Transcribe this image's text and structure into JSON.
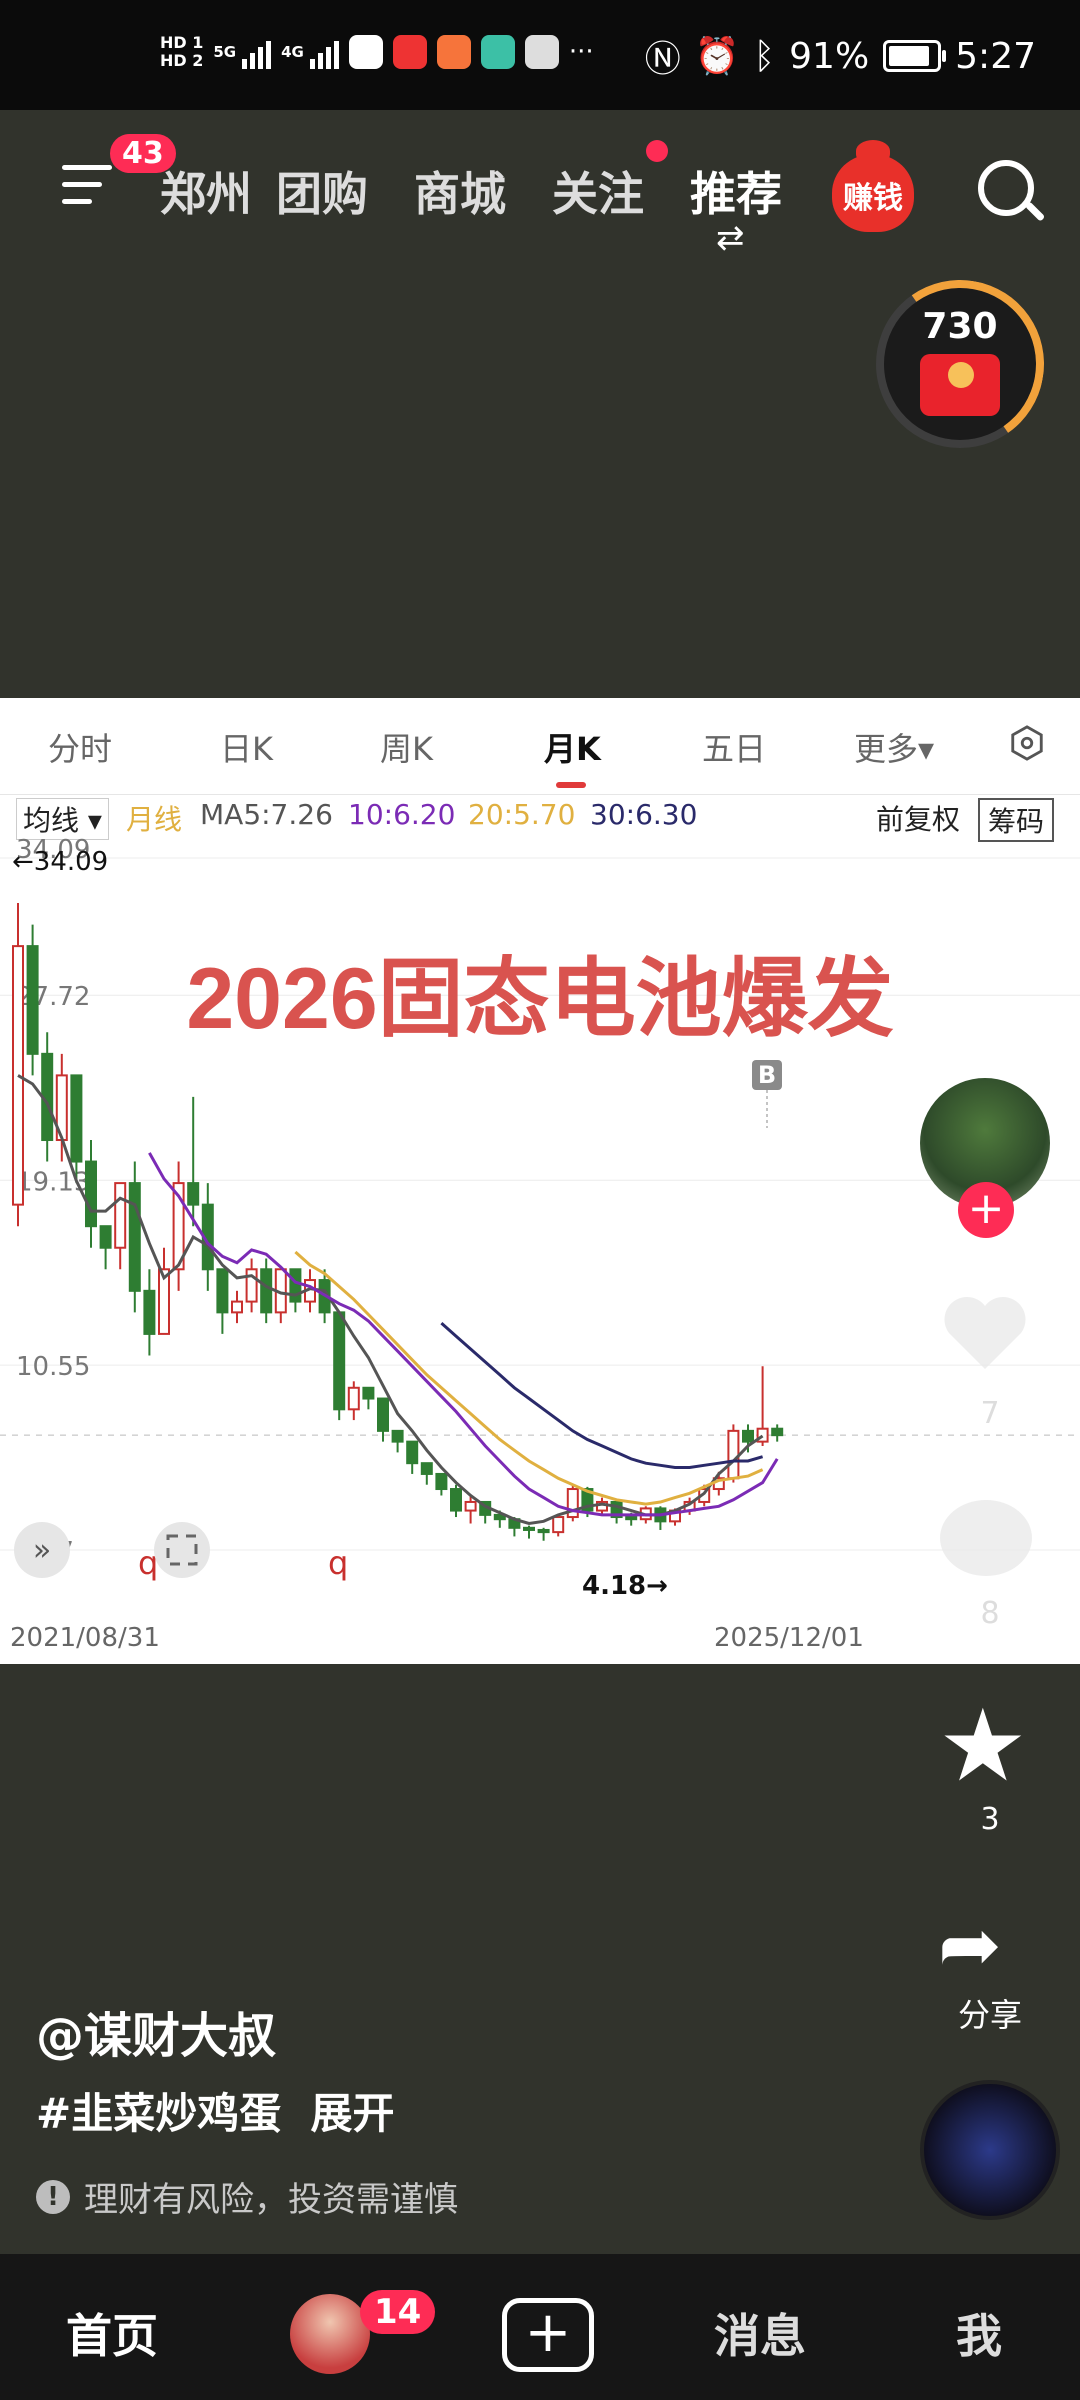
{
  "status_bar": {
    "left_labels": [
      "HD 1",
      "HD 2",
      "5G",
      "4G"
    ],
    "battery_percent": "91%",
    "time": "5:27",
    "icons": [
      "nfc-icon",
      "alarm-icon",
      "bluetooth-icon",
      "battery-icon"
    ]
  },
  "top_nav": {
    "menu_badge": "43",
    "tabs": [
      "郑州",
      "团购",
      "商城",
      "关注",
      "推荐"
    ],
    "earn_label": "赚钱",
    "coin_count": "730"
  },
  "chart_header": {
    "tabs": [
      "分时",
      "日K",
      "周K",
      "月K",
      "五日",
      "更多▾"
    ],
    "active_tab": "月K",
    "ma_select": "均线 ▾",
    "ma_label": "月线",
    "ma_values": [
      "MA5:7.26",
      "10:6.20",
      "20:5.70",
      "30:6.30"
    ],
    "fq_label": "前复权",
    "chouma_label": "筹码"
  },
  "chart_data": {
    "type": "candlestick",
    "title": "2026固态电池爆发",
    "y_ticks": [
      "34.09",
      "27.72",
      "19.13",
      "10.55",
      "1.97"
    ],
    "y_tick_values": [
      34.09,
      27.72,
      19.13,
      10.55,
      1.97
    ],
    "ylim": [
      1.97,
      34.09
    ],
    "high_label": "←34.09",
    "low_label": "4.18→",
    "x_start": "2021/08/31",
    "x_end": "2025/12/01",
    "marker_label": "B",
    "q_labels": [
      "q",
      "q"
    ],
    "candles": [
      {
        "o": 18,
        "c": 30,
        "h": 32,
        "l": 17
      },
      {
        "o": 30,
        "c": 25,
        "h": 31,
        "l": 24
      },
      {
        "o": 25,
        "c": 21,
        "h": 26,
        "l": 20
      },
      {
        "o": 21,
        "c": 24,
        "h": 25,
        "l": 20
      },
      {
        "o": 24,
        "c": 20,
        "h": 24,
        "l": 19
      },
      {
        "o": 20,
        "c": 17,
        "h": 21,
        "l": 16
      },
      {
        "o": 17,
        "c": 16,
        "h": 17,
        "l": 15
      },
      {
        "o": 16,
        "c": 19,
        "h": 19,
        "l": 15
      },
      {
        "o": 19,
        "c": 14,
        "h": 20,
        "l": 13
      },
      {
        "o": 14,
        "c": 12,
        "h": 15,
        "l": 11
      },
      {
        "o": 12,
        "c": 15,
        "h": 16,
        "l": 12
      },
      {
        "o": 15,
        "c": 19,
        "h": 20,
        "l": 14
      },
      {
        "o": 19,
        "c": 18,
        "h": 23,
        "l": 17
      },
      {
        "o": 18,
        "c": 15,
        "h": 19,
        "l": 14
      },
      {
        "o": 15,
        "c": 13,
        "h": 15,
        "l": 12
      },
      {
        "o": 13,
        "c": 13.5,
        "h": 14,
        "l": 12.5
      },
      {
        "o": 13.5,
        "c": 15,
        "h": 15.5,
        "l": 13
      },
      {
        "o": 15,
        "c": 13,
        "h": 15.5,
        "l": 12.5
      },
      {
        "o": 13,
        "c": 15,
        "h": 15,
        "l": 12.5
      },
      {
        "o": 15,
        "c": 13.5,
        "h": 15,
        "l": 13
      },
      {
        "o": 13.5,
        "c": 14.5,
        "h": 15,
        "l": 13
      },
      {
        "o": 14.5,
        "c": 13,
        "h": 15,
        "l": 12.5
      },
      {
        "o": 13,
        "c": 8.5,
        "h": 13,
        "l": 8
      },
      {
        "o": 8.5,
        "c": 9.5,
        "h": 9.8,
        "l": 8
      },
      {
        "o": 9.5,
        "c": 9,
        "h": 9.5,
        "l": 8.5
      },
      {
        "o": 9,
        "c": 7.5,
        "h": 9,
        "l": 7
      },
      {
        "o": 7.5,
        "c": 7,
        "h": 7.5,
        "l": 6.5
      },
      {
        "o": 7,
        "c": 6,
        "h": 7,
        "l": 5.5
      },
      {
        "o": 6,
        "c": 5.5,
        "h": 6,
        "l": 5
      },
      {
        "o": 5.5,
        "c": 4.8,
        "h": 5.5,
        "l": 4.5
      },
      {
        "o": 4.8,
        "c": 3.8,
        "h": 5,
        "l": 3.5
      },
      {
        "o": 3.8,
        "c": 4.2,
        "h": 4.5,
        "l": 3.2
      },
      {
        "o": 4.2,
        "c": 3.6,
        "h": 4.2,
        "l": 3.2
      },
      {
        "o": 3.6,
        "c": 3.4,
        "h": 3.8,
        "l": 3
      },
      {
        "o": 3.4,
        "c": 3,
        "h": 3.5,
        "l": 2.6
      },
      {
        "o": 3,
        "c": 2.9,
        "h": 3.1,
        "l": 2.5
      },
      {
        "o": 2.9,
        "c": 2.8,
        "h": 3,
        "l": 2.4
      },
      {
        "o": 2.8,
        "c": 3.5,
        "h": 3.6,
        "l": 2.6
      },
      {
        "o": 3.5,
        "c": 4.8,
        "h": 5,
        "l": 3.3
      },
      {
        "o": 4.8,
        "c": 3.8,
        "h": 4.9,
        "l": 3.5
      },
      {
        "o": 3.8,
        "c": 4.2,
        "h": 4.4,
        "l": 3.6
      },
      {
        "o": 4.2,
        "c": 3.5,
        "h": 4.3,
        "l": 3.2
      },
      {
        "o": 3.5,
        "c": 3.4,
        "h": 3.7,
        "l": 3.1
      },
      {
        "o": 3.4,
        "c": 3.9,
        "h": 4,
        "l": 3.2
      },
      {
        "o": 3.9,
        "c": 3.3,
        "h": 4,
        "l": 2.9
      },
      {
        "o": 3.3,
        "c": 3.8,
        "h": 3.9,
        "l": 3.1
      },
      {
        "o": 3.8,
        "c": 4.2,
        "h": 4.4,
        "l": 3.6
      },
      {
        "o": 4.2,
        "c": 4.8,
        "h": 5,
        "l": 4
      },
      {
        "o": 4.8,
        "c": 5.3,
        "h": 5.6,
        "l": 4.5
      },
      {
        "o": 5.3,
        "c": 7.5,
        "h": 7.8,
        "l": 5.1
      },
      {
        "o": 7.5,
        "c": 7,
        "h": 7.8,
        "l": 6.5
      },
      {
        "o": 7,
        "c": 7.6,
        "h": 10.5,
        "l": 6.8
      },
      {
        "o": 7.6,
        "c": 7.3,
        "h": 7.8,
        "l": 7
      }
    ],
    "ma_lines": [
      {
        "name": "MA5",
        "color": "#555555",
        "start": 0,
        "values": [
          24.0,
          23.6,
          22.7,
          21.1,
          19.1,
          17.7,
          17.7,
          18.3,
          18.0,
          16.2,
          14.6,
          15.2,
          16.5,
          16.1,
          15.2,
          14.6,
          14.7,
          14.2,
          13.9,
          13.8,
          14.1,
          14.0,
          13.0,
          11.9,
          10.9,
          9.6,
          8.3,
          7.5,
          6.6,
          5.8,
          5.1,
          4.5,
          4.0,
          3.7,
          3.4,
          3.2,
          3.3,
          3.6,
          3.8,
          4.0,
          4.1,
          4.0,
          3.8,
          3.6,
          3.6,
          3.8,
          4.1,
          4.6,
          5.5,
          6.1,
          6.8,
          7.26
        ]
      },
      {
        "name": "MA10",
        "color": "#7b2bb5",
        "start": 9,
        "values": [
          20.4,
          19.2,
          18.4,
          17.3,
          16.2,
          15.6,
          15.3,
          15.9,
          15.7,
          15.1,
          14.4,
          14.2,
          13.8,
          13.4,
          13.1,
          12.6,
          11.9,
          11.2,
          10.5,
          9.8,
          9.1,
          8.4,
          7.6,
          6.8,
          6.1,
          5.4,
          4.8,
          4.4,
          4.0,
          3.8,
          3.7,
          3.6,
          3.6,
          3.6,
          3.6,
          3.6,
          3.7,
          3.8,
          3.9,
          4.0,
          4.3,
          4.7,
          5.1,
          6.2
        ]
      },
      {
        "name": "MA20",
        "color": "#e0b040",
        "start": 19,
        "values": [
          15.8,
          15.2,
          14.8,
          14.2,
          13.6,
          12.9,
          12.2,
          11.5,
          10.8,
          10.1,
          9.5,
          8.9,
          8.3,
          7.7,
          7.1,
          6.6,
          6.1,
          5.7,
          5.3,
          5.0,
          4.7,
          4.5,
          4.3,
          4.2,
          4.1,
          4.2,
          4.4,
          4.6,
          4.9,
          5.2,
          5.3,
          5.4,
          5.7
        ]
      },
      {
        "name": "MA30",
        "color": "#2a2a6a",
        "start": 29,
        "values": [
          12.5,
          11.9,
          11.3,
          10.7,
          10.1,
          9.5,
          9.0,
          8.5,
          8.0,
          7.5,
          7.1,
          6.8,
          6.5,
          6.2,
          6.0,
          5.9,
          5.8,
          5.8,
          5.9,
          6.0,
          6.1,
          6.1,
          6.3
        ]
      }
    ]
  },
  "side_actions": {
    "like_count": "7",
    "comment_count": "8",
    "favorite_count": "3",
    "share_label": "分享"
  },
  "post": {
    "author": "@谋财大叔",
    "hashtag": "#韭菜炒鸡蛋",
    "expand": "展开",
    "risk_notice": "理财有风险，投资需谨慎"
  },
  "bottom_nav": {
    "items": [
      "首页",
      "消息",
      "我"
    ],
    "friends_badge": "14"
  },
  "colors": {
    "up": "#c8302e",
    "down": "#2e7d32",
    "accent": "#fe2c55"
  }
}
